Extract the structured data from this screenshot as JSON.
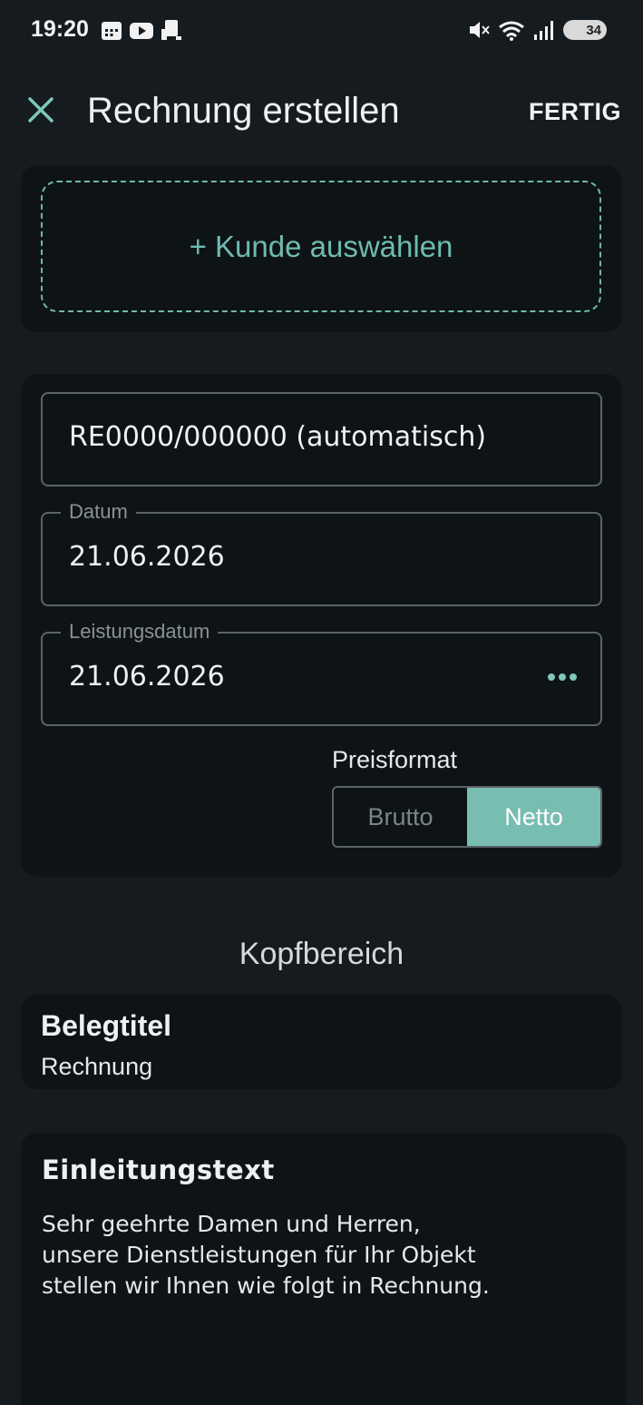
{
  "status_bar": {
    "time": "19:20",
    "battery": "34",
    "icons": [
      "calendar-icon",
      "youtube-icon",
      "cast-icon",
      "mute-icon",
      "wifi-icon",
      "signal-icon",
      "battery-icon"
    ]
  },
  "app_bar": {
    "close_icon": "close-icon",
    "title": "Rechnung erstellen",
    "done_label": "FERTIG"
  },
  "customer": {
    "select_label": "+ Kunde auswählen"
  },
  "form": {
    "invoice_number": "RE0000/000000 (automatisch)",
    "date_label": "Datum",
    "date_value": "21.06.2026",
    "service_date_label": "Leistungsdatum",
    "service_date_value": "21.06.2026",
    "price_format_label": "Preisformat",
    "price_options": [
      "Brutto",
      "Netto"
    ],
    "price_selected": "Netto"
  },
  "header_section": {
    "heading": "Kopfbereich",
    "doc_title_label": "Belegtitel",
    "doc_title_value": "Rechnung",
    "intro_label": "Einleitungstext",
    "intro_text": "Sehr geehrte Damen und Herren,\nunsere Dienstleistungen für Ihr Objekt\nstellen wir Ihnen wie folgt in Rechnung."
  },
  "colors": {
    "accent": "#77bdb2",
    "background": "#151b1f",
    "card": "#0e1316"
  }
}
